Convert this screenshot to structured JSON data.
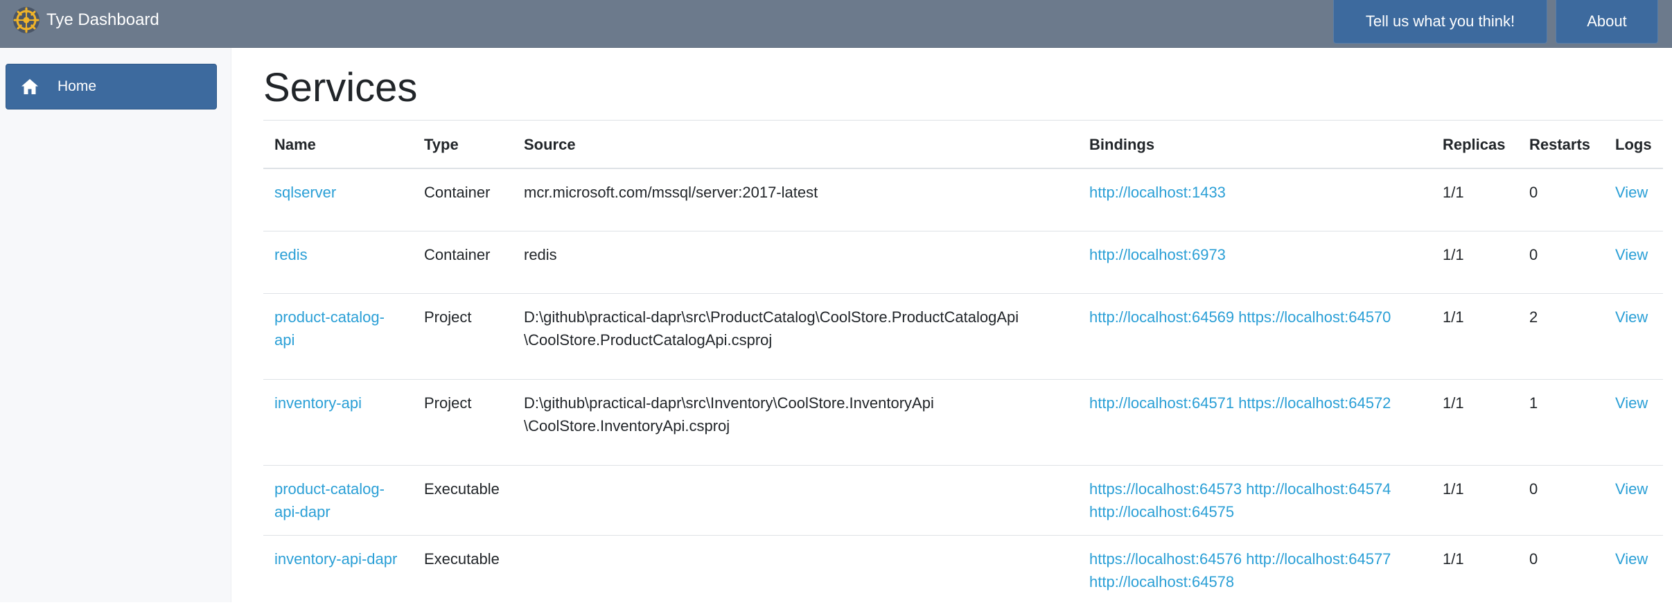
{
  "header": {
    "title": "Tye Dashboard",
    "logo_icon": "tye-logo-icon",
    "feedback_label": "Tell us what you think!",
    "about_label": "About",
    "bar_color": "#6c7a8c",
    "button_color": "#3d6a9e"
  },
  "sidebar": {
    "items": [
      {
        "label": "Home",
        "icon": "home-icon",
        "active": true
      }
    ]
  },
  "main": {
    "title": "Services",
    "table": {
      "columns": [
        "Name",
        "Type",
        "Source",
        "Bindings",
        "Replicas",
        "Restarts",
        "Logs"
      ],
      "rows": [
        {
          "name_lines": [
            "sqlserver"
          ],
          "type": "Container",
          "source_lines": [
            "mcr.microsoft.com/mssql/server:2017-latest"
          ],
          "bindings_lines": [
            "http://localhost:1433"
          ],
          "replicas": "1/1",
          "restarts": "0",
          "logs": "View"
        },
        {
          "name_lines": [
            "redis"
          ],
          "type": "Container",
          "source_lines": [
            "redis"
          ],
          "bindings_lines": [
            "http://localhost:6973"
          ],
          "replicas": "1/1",
          "restarts": "0",
          "logs": "View"
        },
        {
          "name_lines": [
            "product-catalog-",
            "api"
          ],
          "type": "Project",
          "source_lines": [
            "D:\\github\\practical-dapr\\src\\ProductCatalog\\CoolStore.ProductCatalogApi",
            "\\CoolStore.ProductCatalogApi.csproj"
          ],
          "bindings_lines": [
            "http://localhost:64569 https://localhost:64570"
          ],
          "replicas": "1/1",
          "restarts": "2",
          "logs": "View"
        },
        {
          "name_lines": [
            "inventory-api"
          ],
          "type": "Project",
          "source_lines": [
            "D:\\github\\practical-dapr\\src\\Inventory\\CoolStore.InventoryApi",
            "\\CoolStore.InventoryApi.csproj"
          ],
          "bindings_lines": [
            "http://localhost:64571 https://localhost:64572"
          ],
          "replicas": "1/1",
          "restarts": "1",
          "logs": "View"
        },
        {
          "name_lines": [
            "product-catalog-",
            "api-dapr"
          ],
          "type": "Executable",
          "source_lines": [
            ""
          ],
          "bindings_lines": [
            "https://localhost:64573 http://localhost:64574",
            "http://localhost:64575"
          ],
          "replicas": "1/1",
          "restarts": "0",
          "logs": "View"
        },
        {
          "name_lines": [
            "inventory-api-dapr"
          ],
          "type": "Executable",
          "source_lines": [
            ""
          ],
          "bindings_lines": [
            "https://localhost:64576 http://localhost:64577",
            "http://localhost:64578"
          ],
          "replicas": "1/1",
          "restarts": "0",
          "logs": "View"
        }
      ]
    }
  },
  "colors": {
    "link": "#2a9fd6",
    "sidebar_bg": "#f7f8fa"
  }
}
